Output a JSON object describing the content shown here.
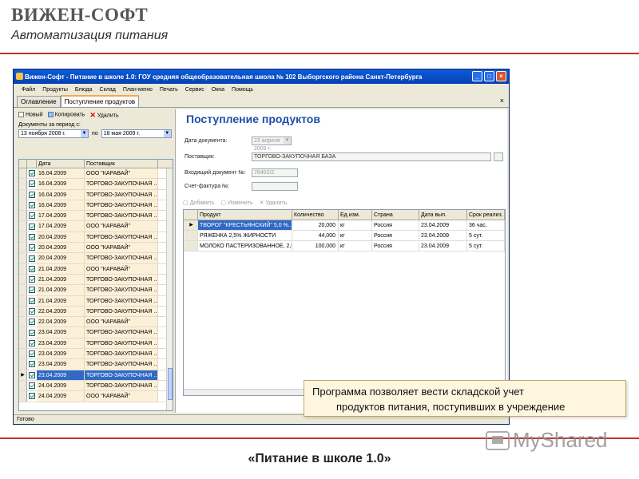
{
  "slide": {
    "brand": "ВИЖЕН-СОФТ",
    "subtitle": "Автоматизация питания",
    "footer": "«Питание в школе 1.0»",
    "watermark": "MyShared",
    "callout_line1": "Программа позволяет вести складской учет",
    "callout_line2": "продуктов питания, поступивших в учреждение",
    "accent_color": "#c8312a"
  },
  "window": {
    "title": "Вижен-Софт - Питание в школе 1.0: ГОУ средняя общеобразовательная школа № 102 Выборгского района Санкт-Петербурга",
    "menu": [
      "Файл",
      "Продукты",
      "Блюда",
      "Склад",
      "План-меню",
      "Печать",
      "Сервис",
      "Окна",
      "Помощь"
    ],
    "tabs": [
      "Оглавление",
      "Поступление продуктов"
    ],
    "status": "Готово"
  },
  "left": {
    "toolbar": {
      "new": "Новый",
      "copy": "Копировать",
      "delete": "Удалить"
    },
    "period_label": "Документы за период с:",
    "date_from": "13 ноября 2008 г.",
    "to_label": "по",
    "date_to": "18 мая 2009 г.",
    "columns": [
      "Дата",
      "Поставщик"
    ],
    "rows": [
      {
        "date": "16.04.2009",
        "supplier": "ООО \"КАРАВАЙ\""
      },
      {
        "date": "16.04.2009",
        "supplier": "ТОРГОВО-ЗАКУПОЧНАЯ ..."
      },
      {
        "date": "16.04.2009",
        "supplier": "ТОРГОВО-ЗАКУПОЧНАЯ ..."
      },
      {
        "date": "16.04.2009",
        "supplier": "ТОРГОВО-ЗАКУПОЧНАЯ ..."
      },
      {
        "date": "17.04.2009",
        "supplier": "ТОРГОВО-ЗАКУПОЧНАЯ ..."
      },
      {
        "date": "17.04.2009",
        "supplier": "ООО \"КАРАВАЙ\""
      },
      {
        "date": "20.04.2009",
        "supplier": "ТОРГОВО-ЗАКУПОЧНАЯ ..."
      },
      {
        "date": "20.04.2009",
        "supplier": "ООО \"КАРАВАЙ\""
      },
      {
        "date": "20.04.2009",
        "supplier": "ТОРГОВО-ЗАКУПОЧНАЯ ..."
      },
      {
        "date": "21.04.2009",
        "supplier": "ООО \"КАРАВАЙ\""
      },
      {
        "date": "21.04.2009",
        "supplier": "ТОРГОВО-ЗАКУПОЧНАЯ ..."
      },
      {
        "date": "21.04.2009",
        "supplier": "ТОРГОВО-ЗАКУПОЧНАЯ ..."
      },
      {
        "date": "21.04.2009",
        "supplier": "ТОРГОВО-ЗАКУПОЧНАЯ ..."
      },
      {
        "date": "22.04.2009",
        "supplier": "ТОРГОВО-ЗАКУПОЧНАЯ ..."
      },
      {
        "date": "22.04.2009",
        "supplier": "ООО \"КАРАВАЙ\""
      },
      {
        "date": "23.04.2009",
        "supplier": "ТОРГОВО-ЗАКУПОЧНАЯ ..."
      },
      {
        "date": "23.04.2009",
        "supplier": "ТОРГОВО-ЗАКУПОЧНАЯ ..."
      },
      {
        "date": "23.04.2009",
        "supplier": "ТОРГОВО-ЗАКУПОЧНАЯ ..."
      },
      {
        "date": "23.04.2009",
        "supplier": "ТОРГОВО-ЗАКУПОЧНАЯ ..."
      },
      {
        "date": "23.04.2009",
        "supplier": "ТОРГОВО-ЗАКУПОЧНАЯ ..."
      },
      {
        "date": "24.04.2009",
        "supplier": "ТОРГОВО-ЗАКУПОЧНАЯ ..."
      },
      {
        "date": "24.04.2009",
        "supplier": "ООО \"КАРАВАЙ\""
      }
    ],
    "selected_row_index": 19
  },
  "right": {
    "title": "Поступление продуктов",
    "doc_date_label": "Дата документа:",
    "doc_date_value": "23 апреля 2009 г.",
    "supplier_label": "Поставщик:",
    "supplier_value": "ТОРГОВО-ЗАКУПОЧНАЯ БАЗА",
    "incoming_label": "Входящий документ №:",
    "incoming_value": "76402/2",
    "invoice_label": "Счет-фактура №:",
    "invoice_value": "",
    "tools": {
      "add": "Добавить",
      "edit": "Изменить",
      "delete": "Удалить"
    },
    "columns": [
      "Продукт",
      "Количество",
      "Ед.изм.",
      "Страна",
      "Дата вып.",
      "Срок реализ."
    ],
    "rows": [
      {
        "product": "ТВОРОГ \"КРЕСТЬЯНСКИЙ\" 5,0 %...",
        "qty": "20,000",
        "unit": "кг",
        "country": "Россия",
        "date": "23.04.2009",
        "term": "36 час."
      },
      {
        "product": "РЯЖЕНКА 2,5% ЖИРНОСТИ",
        "qty": "44,000",
        "unit": "кг",
        "country": "Россия",
        "date": "23.04.2009",
        "term": "5 сут."
      },
      {
        "product": "МОЛОКО ПАСТЕРИЗОВАННОЕ, 2,5...",
        "qty": "100,000",
        "unit": "кг",
        "country": "Россия",
        "date": "23.04.2009",
        "term": "5 сут."
      }
    ]
  }
}
